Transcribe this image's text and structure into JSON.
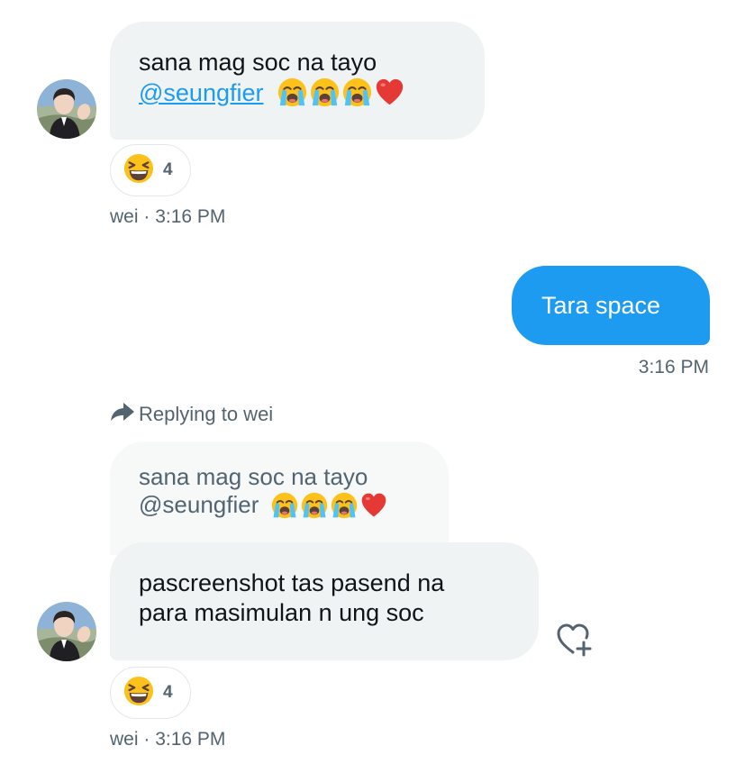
{
  "messages": [
    {
      "sender": "wei",
      "text_line1": "sana mag soc na tayo",
      "mention": "@seungfier",
      "emojis": [
        "loudly-crying-face",
        "loudly-crying-face",
        "loudly-crying-face",
        "red-heart"
      ],
      "reaction": {
        "emoji": "grinning-squinting-face",
        "count": "4"
      },
      "meta_sender": "wei",
      "meta_time": "3:16 PM"
    },
    {
      "sender": "me",
      "text": "Tara space",
      "meta_time": "3:16 PM"
    },
    {
      "sender": "wei",
      "replying_label": "Replying to wei",
      "quoted_line1": "sana mag soc na tayo",
      "quoted_line2": "@seungfier",
      "text_line1": "pascreenshot tas pasend na",
      "text_line2": "para masimulan n ung soc",
      "reaction": {
        "emoji": "grinning-squinting-face",
        "count": "4"
      },
      "meta_sender": "wei",
      "meta_time": "3:16 PM"
    }
  ],
  "colors": {
    "accent": "#1d9bf0",
    "bubble_in": "#eff3f4",
    "muted_text": "#536471"
  },
  "icons": [
    "reply-arrow-icon",
    "add-reaction-icon"
  ]
}
